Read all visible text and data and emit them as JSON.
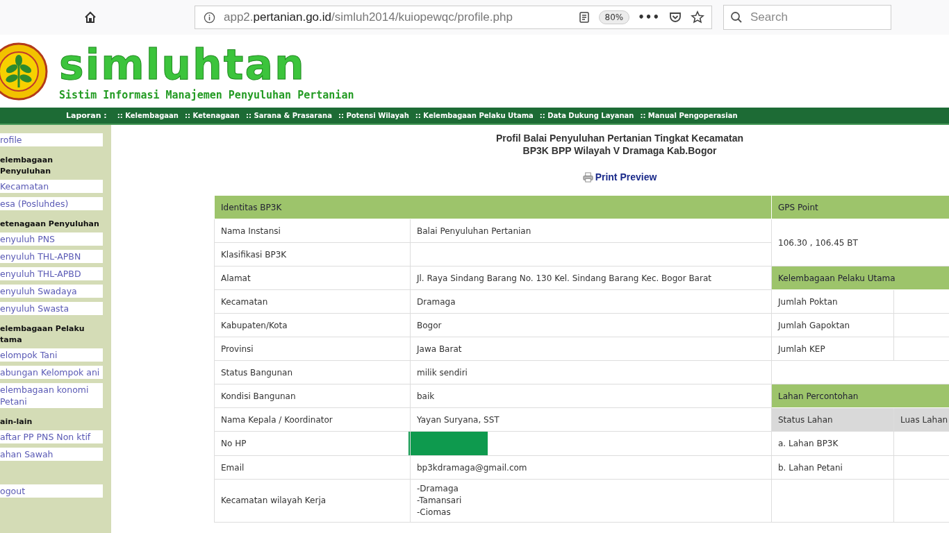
{
  "browser": {
    "url": "app2.**pertanian.go.id**/simluh2014/kuiopewqc/profile.php",
    "zoom": "80%",
    "menu": "•••",
    "search": {
      "placeholder": "Search"
    }
  },
  "header": {
    "logo_text": "simluhtan",
    "subtitle": "Sistim Informasi Manajemen Penyuluhan Pertanian"
  },
  "nav": {
    "label": "Laporan :",
    "items": [
      ":: Kelembagaan",
      ":: Ketenagaan",
      ":: Sarana & Prasarana",
      ":: Potensi Wilayah",
      ":: Kelembagaan Pelaku Utama",
      ":: Data Dukung Layanan",
      ":: Manual Pengoperasian"
    ]
  },
  "sidebar": {
    "items": [
      {
        "kind": "link",
        "text": "rofile"
      },
      {
        "kind": "heading",
        "text": "elembagaan Penyuluhan"
      },
      {
        "kind": "link",
        "text": "Kecamatan"
      },
      {
        "kind": "link",
        "text": "esa (Posluhdes)"
      },
      {
        "kind": "heading",
        "text": "etenagaan Penyuluhan"
      },
      {
        "kind": "link",
        "text": "enyuluh PNS"
      },
      {
        "kind": "link",
        "text": "enyuluh THL-APBN"
      },
      {
        "kind": "link",
        "text": "enyuluh THL-APBD"
      },
      {
        "kind": "link",
        "text": "enyuluh Swadaya"
      },
      {
        "kind": "link",
        "text": "enyuluh Swasta"
      },
      {
        "kind": "heading",
        "text": "elembagaan Pelaku tama"
      },
      {
        "kind": "link",
        "text": "elompok Tani"
      },
      {
        "kind": "link",
        "text": "abungan Kelompok ani"
      },
      {
        "kind": "link",
        "text": "elembagaan konomi Petani"
      },
      {
        "kind": "heading",
        "text": "ain-lain"
      },
      {
        "kind": "link",
        "text": "aftar PP PNS Non ktif"
      },
      {
        "kind": "link",
        "text": "ahan Sawah"
      },
      {
        "kind": "gap"
      },
      {
        "kind": "link",
        "text": "ogout"
      }
    ]
  },
  "title_lines": [
    "Profil Balai Penyuluhan Pertanian Tingkat Kecamatan",
    "BP3K BPP Wilayah V Dramaga Kab.Bogor"
  ],
  "print_link": "Print Preview",
  "profile_table": {
    "header": "Identitas BP3K",
    "rows": [
      {
        "label": "Nama Instansi",
        "value": [
          "Balai Penyuluhan Pertanian"
        ]
      },
      {
        "label": "Klasifikasi BP3K",
        "value": []
      },
      {
        "label": "Alamat",
        "value": [
          "Jl. Raya Sindang Barang No. 130 Kel. Sindang Barang Kec. Bogor Barat"
        ]
      },
      {
        "label": "Kecamatan",
        "value": [
          "Dramaga"
        ]
      },
      {
        "label": "Kabupaten/Kota",
        "value": [
          "Bogor"
        ]
      },
      {
        "label": "Provinsi",
        "value": [
          "Jawa Barat"
        ]
      },
      {
        "label": "Status Bangunan",
        "value": [
          "milik sendiri"
        ]
      },
      {
        "label": "Kondisi Bangunan",
        "value": [
          "baik"
        ]
      },
      {
        "label": "Nama Kepala / Koordinator",
        "value": [
          "Yayan Suryana, SST"
        ]
      },
      {
        "label": "No HP",
        "value": [],
        "redacted": true
      },
      {
        "label": "Email",
        "value": [
          "bp3kdramaga@gmail.com"
        ]
      },
      {
        "label": "Kecamatan wilayah Kerja",
        "value": [
          "-Dramaga",
          "-Tamansari",
          "-Ciomas"
        ]
      }
    ]
  },
  "side_table": [
    {
      "kind": "header",
      "text": "GPS Point"
    },
    {
      "kind": "tall",
      "text": "106.30 , 106.45 BT"
    },
    {
      "kind": "header",
      "text": "Kelembagaan Pelaku Utama"
    },
    {
      "kind": "pair",
      "text": "Jumlah Poktan"
    },
    {
      "kind": "pair",
      "text": "Jumlah Gapoktan"
    },
    {
      "kind": "pair",
      "text": "Jumlah KEP"
    },
    {
      "kind": "blank"
    },
    {
      "kind": "header",
      "text": "Lahan Percontohan"
    },
    {
      "kind": "columns",
      "cells": [
        "Status Lahan",
        "Luas Lahan"
      ]
    },
    {
      "kind": "pair",
      "text": "a. Lahan BP3K"
    },
    {
      "kind": "pair",
      "text": "b. Lahan Petani"
    },
    {
      "kind": "pair"
    }
  ]
}
